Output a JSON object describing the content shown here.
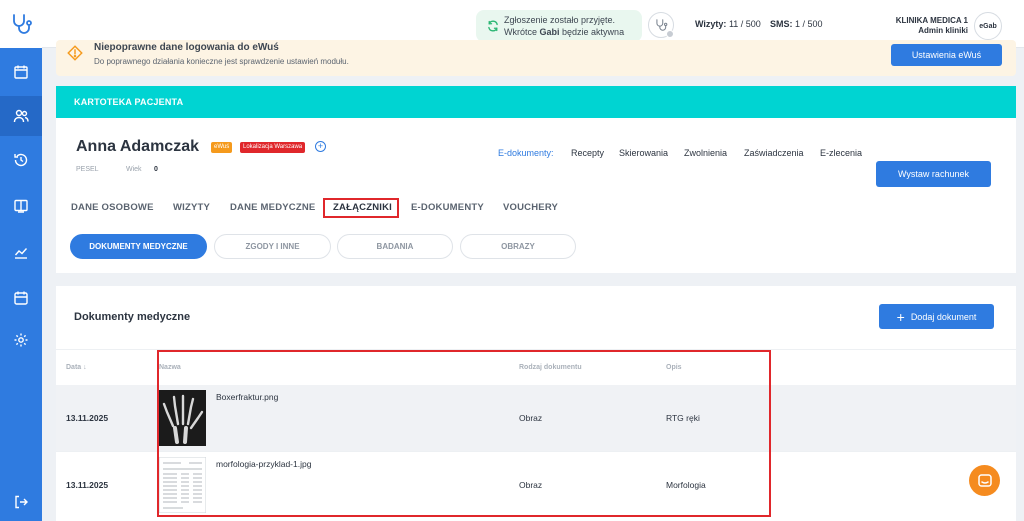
{
  "topbar": {
    "notification_line1": "Zgłoszenie zostało przyjęte.",
    "notification_line2_prefix": "Wkrótce ",
    "notification_line2_name": "Gabi",
    "notification_line2_suffix": " będzie aktywna",
    "visits_label": "Wizyty:",
    "visits_value": "11 / 500",
    "sms_label": "SMS:",
    "sms_value": "1 / 500",
    "clinic_name": "KLINIKA MEDICA 1",
    "user_role": "Admin kliniki",
    "avatar_text": "eGab"
  },
  "warning": {
    "title": "Niepoprawne dane logowania do eWuś",
    "description": "Do poprawnego działania konieczne jest sprawdzenie ustawień modułu.",
    "button": "Ustawienia eWuś"
  },
  "card": {
    "header": "KARTOTEKA PACJENTA",
    "patient_name": "Anna Adamczak",
    "badge_ewus": "eWuś",
    "badge_location": "Lokalizacja Warszawa",
    "pesel_label": "PESEL",
    "age_label": "Wiek",
    "age_value": "0",
    "edocs_label": "E-dokumenty:",
    "edocs_links": [
      "Recepty",
      "Skierowania",
      "Zwolnienia",
      "Zaświadczenia",
      "E-zlecenia"
    ],
    "bill_button": "Wystaw rachunek",
    "tabs": [
      "DANE OSOBOWE",
      "WIZYTY",
      "DANE MEDYCZNE",
      "ZAŁĄCZNIKI",
      "E-DOKUMENTY",
      "VOUCHERY"
    ],
    "active_tab": "ZAŁĄCZNIKI",
    "subtabs": [
      "DOKUMENTY MEDYCZNE",
      "ZGODY I INNE",
      "BADANIA",
      "OBRAZY"
    ],
    "active_subtab": "DOKUMENTY MEDYCZNE"
  },
  "documents": {
    "title": "Dokumenty medyczne",
    "add_button": "Dodaj dokument",
    "columns": {
      "date": "Data",
      "name": "Nazwa",
      "type": "Rodzaj dokumentu",
      "description": "Opis"
    },
    "rows": [
      {
        "date": "13.11.2025",
        "name": "Boxerfraktur.png",
        "type": "Obraz",
        "description": "RTG ręki"
      },
      {
        "date": "13.11.2025",
        "name": "morfologia-przyklad-1.jpg",
        "type": "Obraz",
        "description": "Morfologia"
      }
    ]
  },
  "colors": {
    "primary": "#2f7be0",
    "teal_header": "#00d4d2",
    "highlight_red": "#e0272b",
    "chat_orange": "#f58b1f"
  }
}
